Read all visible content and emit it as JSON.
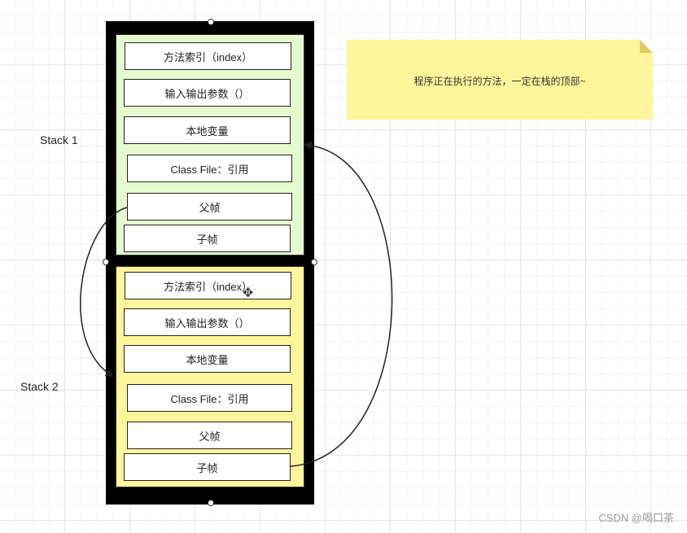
{
  "labels": {
    "stack1": "Stack 1",
    "stack2": "Stack 2"
  },
  "stack1": {
    "frames": [
      "方法索引（index）",
      "输入输出参数（）",
      "本地变量",
      "Class File：引用",
      "父帧",
      "子帧"
    ],
    "color": "#e6fad0"
  },
  "stack2": {
    "frames": [
      "方法索引（index）",
      "输入输出参数（）",
      "本地变量",
      "Class File：引用",
      "父帧",
      "子帧"
    ],
    "color": "#fff59a"
  },
  "note": {
    "text": "程序正在执行的方法，一定在栈的顶部~",
    "color": "#fff59a"
  },
  "watermark": "CSDN @喝口茶",
  "icons": {
    "move_cursor": "move-icon"
  }
}
